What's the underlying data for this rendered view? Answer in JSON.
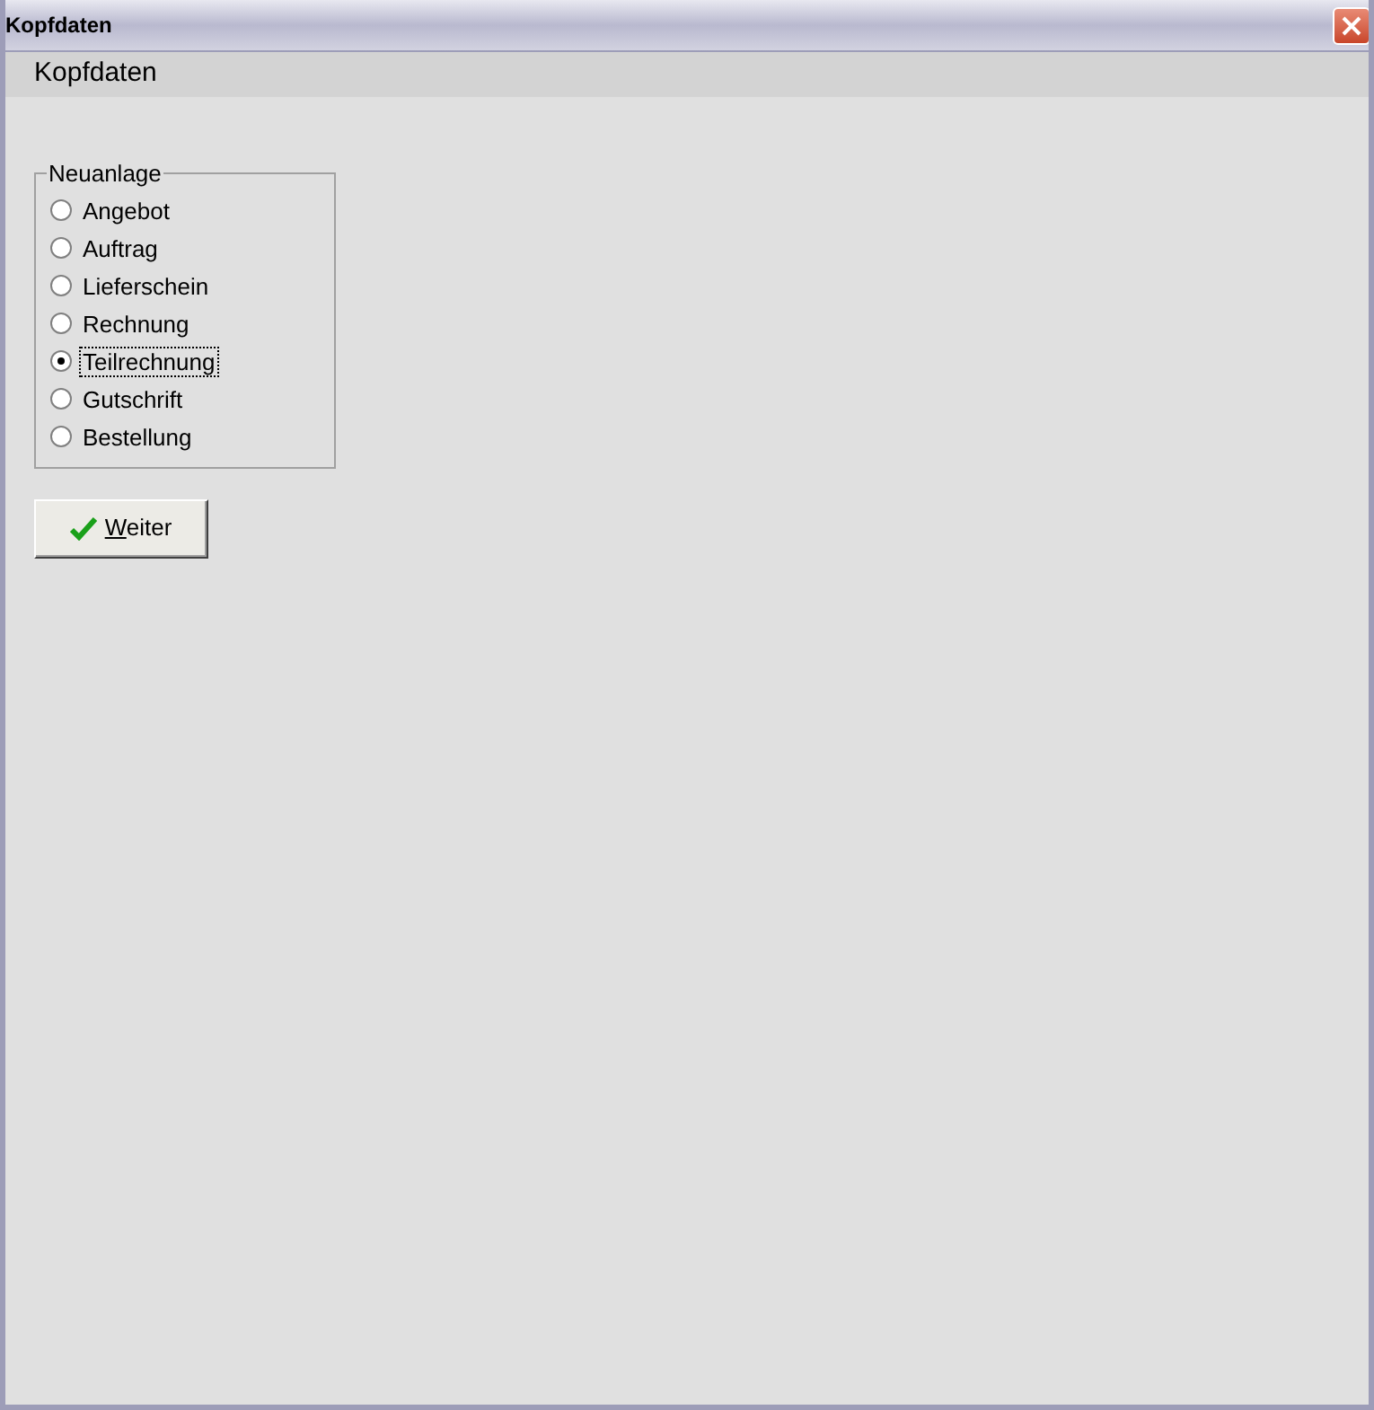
{
  "window": {
    "title": "Kopfdaten"
  },
  "header": {
    "title": "Kopfdaten"
  },
  "group": {
    "legend": "Neuanlage",
    "options": [
      {
        "label": "Angebot",
        "selected": false
      },
      {
        "label": "Auftrag",
        "selected": false
      },
      {
        "label": "Lieferschein",
        "selected": false
      },
      {
        "label": "Rechnung",
        "selected": false
      },
      {
        "label": "Teilrechnung",
        "selected": true
      },
      {
        "label": "Gutschrift",
        "selected": false
      },
      {
        "label": "Bestellung",
        "selected": false
      }
    ]
  },
  "button": {
    "label": "Weiter"
  }
}
